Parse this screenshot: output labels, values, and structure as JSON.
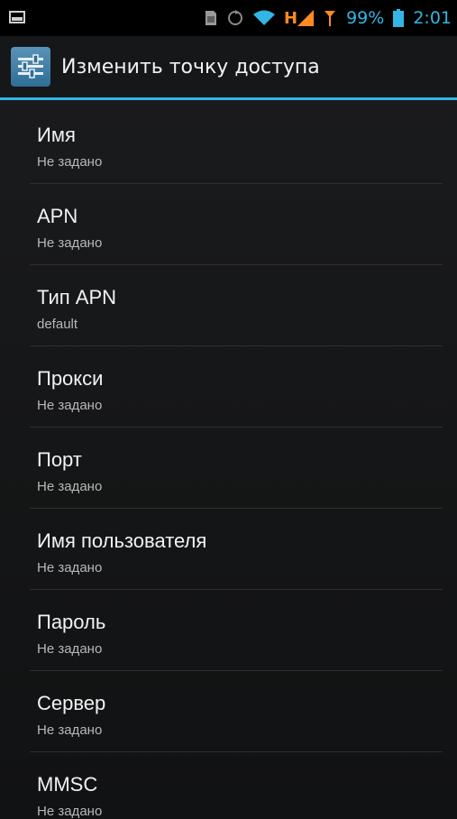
{
  "status_bar": {
    "icons": [
      "screenshot-icon",
      "sim-card-icon",
      "sync-icon",
      "wifi-icon",
      "hplus-signal-icon",
      "antenna-signal-icon",
      "battery-icon"
    ],
    "h_label": "H",
    "battery_percent": "99%",
    "time": "2:01",
    "accent_color": "#33b5e5"
  },
  "action_bar": {
    "title": "Изменить точку доступа",
    "icon": "settings-sliders-icon"
  },
  "items": [
    {
      "label": "Имя",
      "value": "Не задано"
    },
    {
      "label": "APN",
      "value": "Не задано"
    },
    {
      "label": "Тип APN",
      "value": "default"
    },
    {
      "label": "Прокси",
      "value": "Не задано"
    },
    {
      "label": "Порт",
      "value": "Не задано"
    },
    {
      "label": "Имя пользователя",
      "value": "Не задано"
    },
    {
      "label": "Пароль",
      "value": "Не задано"
    },
    {
      "label": "Сервер",
      "value": "Не задано"
    },
    {
      "label": "MMSC",
      "value": "Не задано"
    }
  ]
}
